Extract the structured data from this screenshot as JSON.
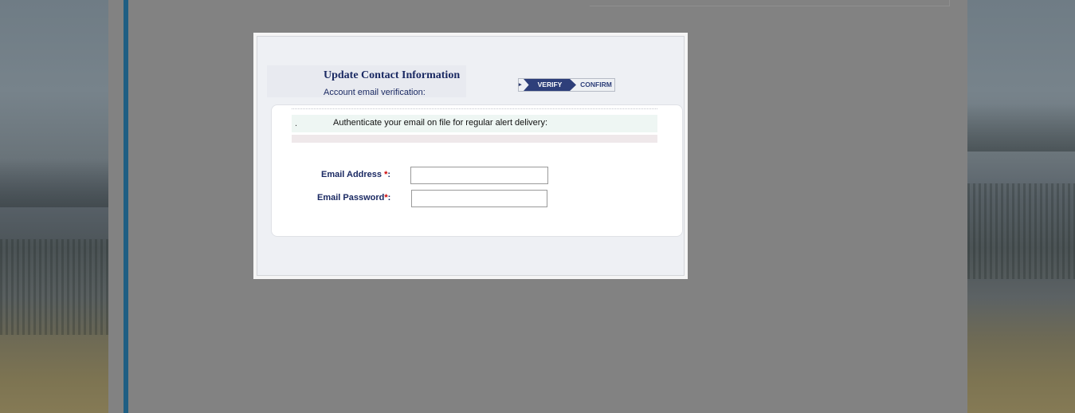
{
  "dialog": {
    "title": "Update Contact Information",
    "subtitle": "Account email verification:",
    "steps": {
      "previous_marker": "▸",
      "active": "VERIFY",
      "next": "CONFIRM"
    },
    "info": {
      "bullet": ".",
      "text": "Authenticate your email on file for regular alert delivery:"
    },
    "form": {
      "email_label": "Email Address ",
      "email_required_mark": "*",
      "email_colon": ":",
      "email_value": "",
      "password_label": "Email Password",
      "password_required_mark": "*",
      "password_colon": ":",
      "password_value": ""
    }
  },
  "colors": {
    "accent_bar": "#1f5e83",
    "title_text": "#1b2a63",
    "step_active_bg": "#2e3f7a",
    "required_mark": "#cc0000"
  }
}
